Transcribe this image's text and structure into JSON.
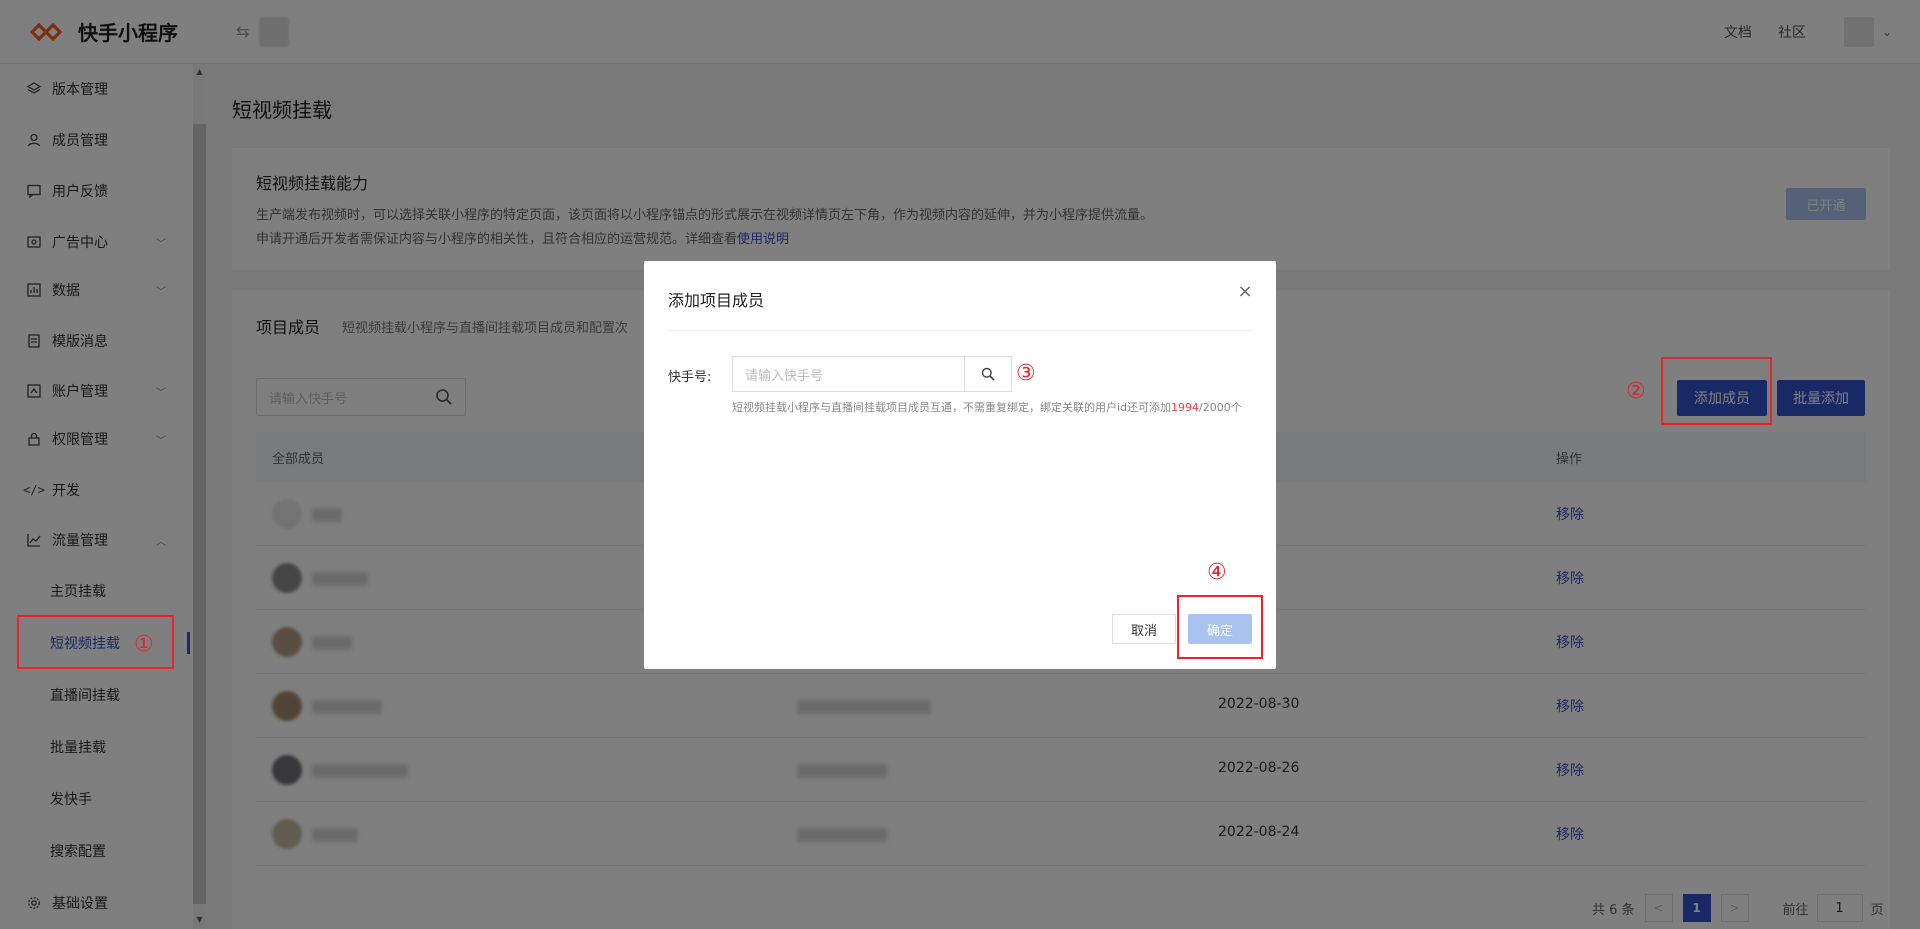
{
  "header": {
    "app_name": "快手小程序",
    "switch_icon": "⇆",
    "links": [
      "文档",
      "社区"
    ],
    "caret": "⌄"
  },
  "sidebar": {
    "items": [
      {
        "label": "版本管理",
        "icon": "layers-icon"
      },
      {
        "label": "成员管理",
        "icon": "user-icon"
      },
      {
        "label": "用户反馈",
        "icon": "message-icon"
      },
      {
        "label": "广告中心",
        "icon": "ad-icon"
      },
      {
        "label": "数据",
        "icon": "chart-icon"
      },
      {
        "label": "模版消息",
        "icon": "template-icon"
      },
      {
        "label": "账户管理",
        "icon": "account-icon"
      },
      {
        "label": "权限管理",
        "icon": "lock-icon"
      },
      {
        "label": "开发",
        "icon": "code-icon"
      },
      {
        "label": "流量管理",
        "icon": "trend-icon"
      }
    ],
    "sub_items": [
      "主页挂载",
      "短视频挂载",
      "直播间挂载",
      "批量挂载",
      "发快手",
      "搜索配置"
    ],
    "bottom": {
      "label": "基础设置",
      "icon": "gear-icon"
    }
  },
  "page": {
    "title": "短视频挂载",
    "capability": {
      "title": "短视频挂载能力",
      "desc_line1": "生产端发布视频时，可以选择关联小程序的特定页面，该页面将以小程序锚点的形式展示在视频详情页左下角，作为视频内容的延伸，并为小程序提供流量。",
      "desc_line2": "申请开通后开发者需保证内容与小程序的相关性，且符合相应的运营规范。详细查看",
      "desc_link": "使用说明",
      "status_button": "已开通"
    },
    "members": {
      "title": "项目成员",
      "subtitle": "短视频挂载小程序与直播间挂载项目成员和配置次",
      "search_placeholder": "请输入快手号",
      "add_button": "添加成员",
      "batch_button": "批量添加",
      "col_all": "全部成员",
      "col_action": "操作",
      "rows": [
        {
          "date": "",
          "action": "移除"
        },
        {
          "date": "",
          "action": "移除"
        },
        {
          "date": "",
          "action": "移除"
        },
        {
          "date": "2022-08-30",
          "action": "移除"
        },
        {
          "date": "2022-08-26",
          "action": "移除"
        },
        {
          "date": "2022-08-24",
          "action": "移除"
        }
      ],
      "pager": {
        "total": "共 6 条",
        "current": "1",
        "goto": "前往",
        "page_value": "1",
        "page_unit": "页",
        "prev": "<",
        "next": ">"
      }
    }
  },
  "modal": {
    "title": "添加项目成员",
    "close": "×",
    "field_label": "快手号:",
    "placeholder": "请输入快手号",
    "hint_prefix": "短视频挂载小程序与直播间挂载项目成员互通，不需重复绑定，绑定关联的用户id还可添加",
    "hint_count": "1994",
    "hint_suffix": "/2000个",
    "cancel": "取消",
    "confirm": "确定"
  },
  "annotations": {
    "mark1": "①",
    "mark2": "②",
    "mark3": "③",
    "mark4": "④",
    "color": "#e5262a"
  },
  "colors": {
    "accent": "#3352cc",
    "disabled_blue": "#a9c2f0",
    "danger": "#e94040"
  }
}
